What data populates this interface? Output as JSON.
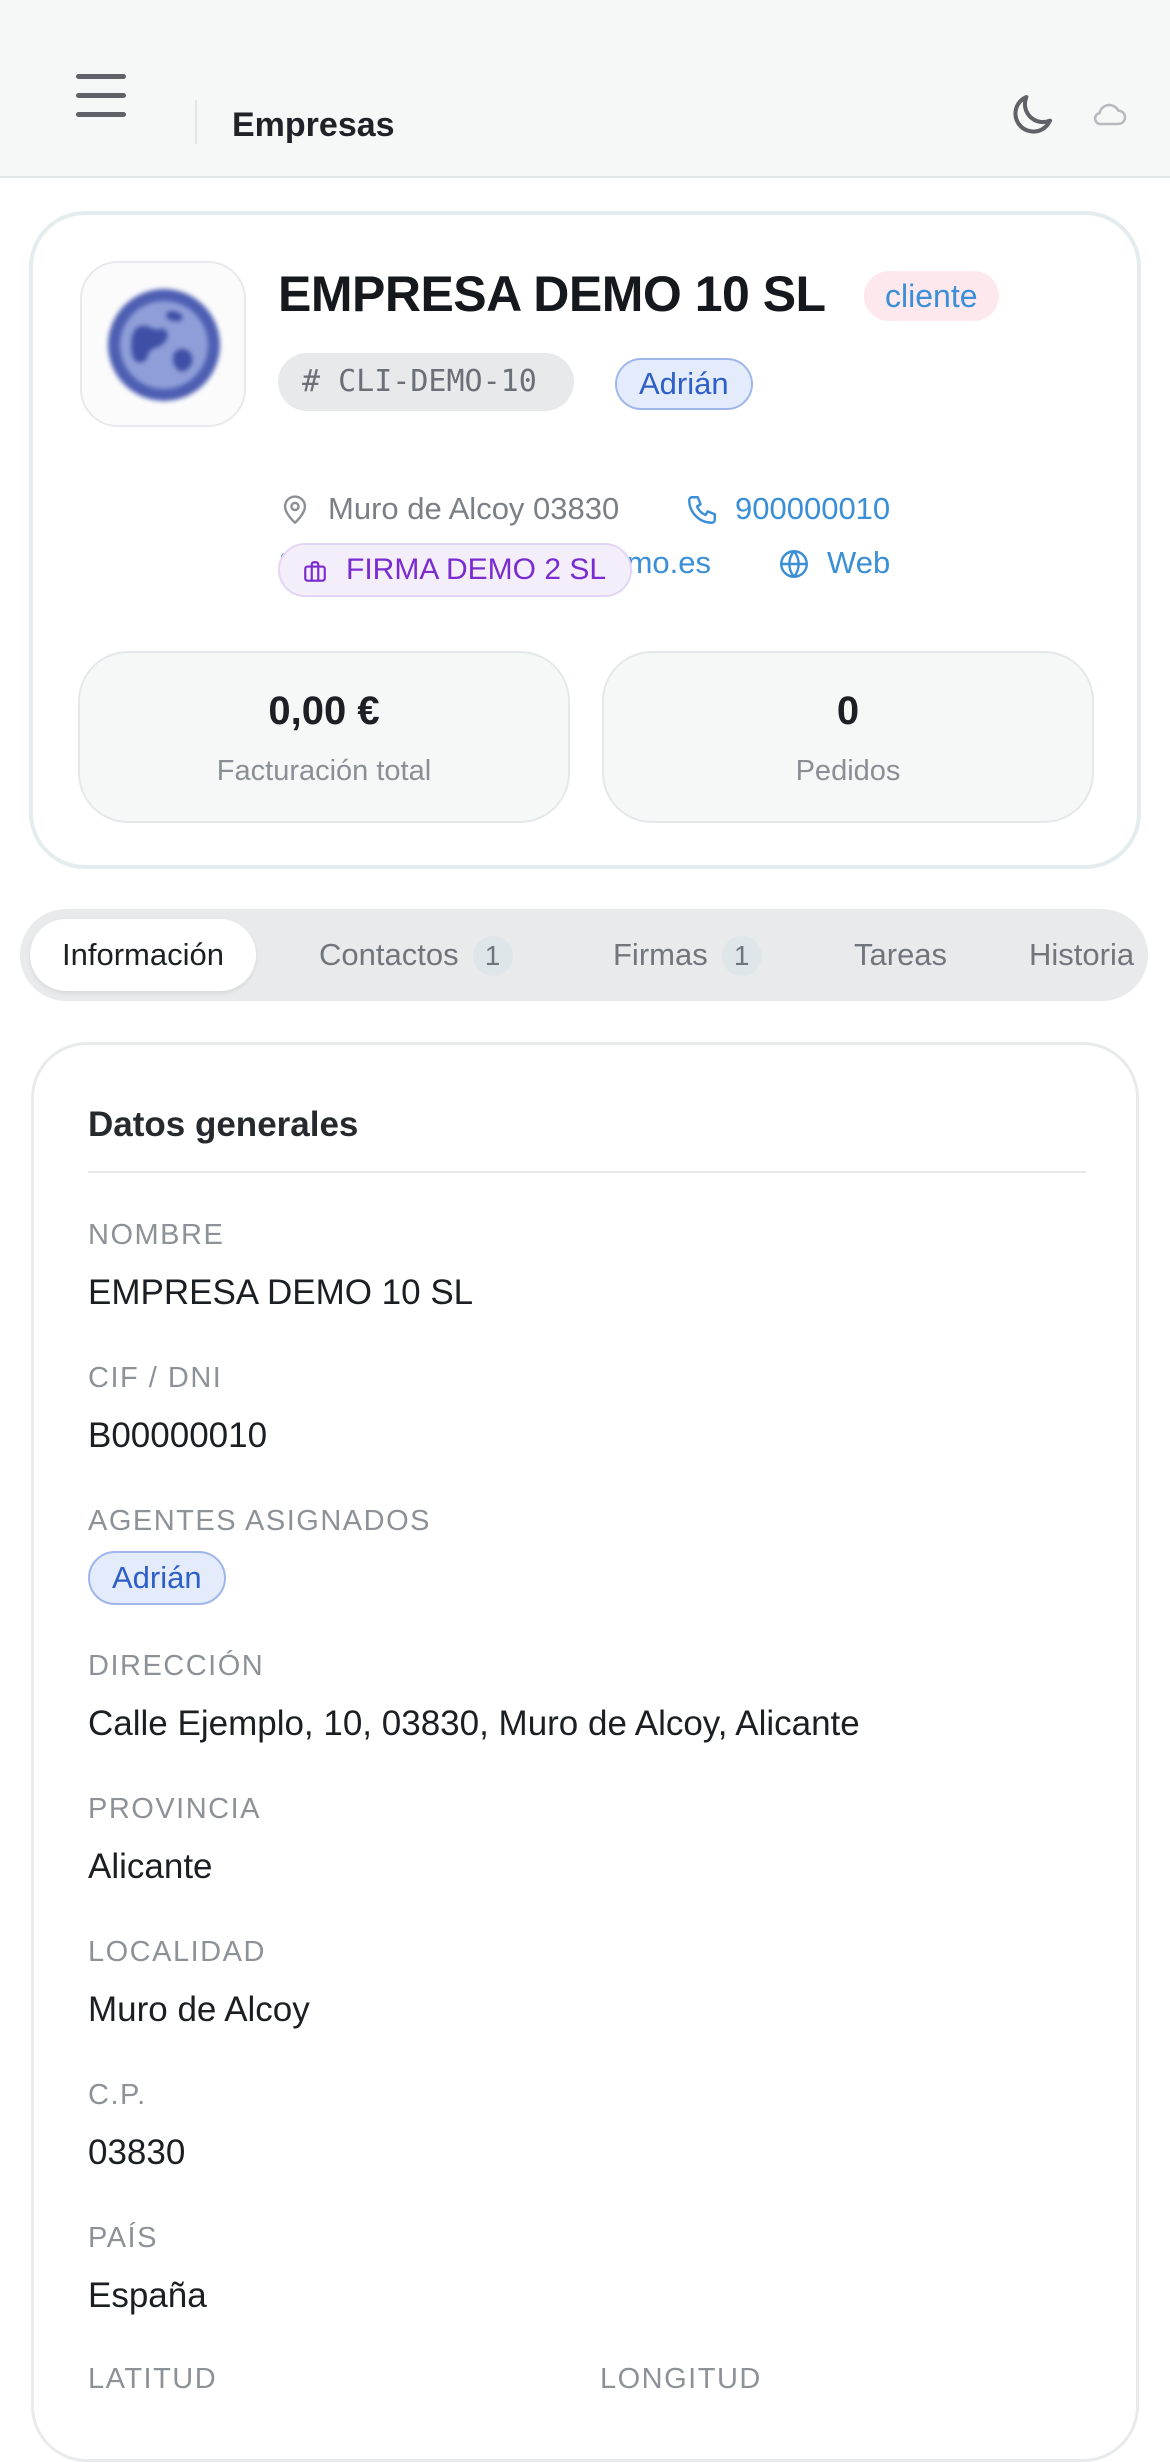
{
  "header": {
    "title": "Empresas"
  },
  "company": {
    "name": "EMPRESA DEMO 10 SL",
    "status": "cliente",
    "code": "# CLI-DEMO-10",
    "agent": "Adrián",
    "location": "Muro de Alcoy 03830",
    "phone": "900000010",
    "email": "demo10@empresademo.es",
    "web": "Web",
    "firma": "FIRMA DEMO 2 SL",
    "stats": [
      {
        "value": "0,00 €",
        "label": "Facturación total"
      },
      {
        "value": "0",
        "label": "Pedidos"
      }
    ]
  },
  "tabs": [
    {
      "label": "Información",
      "active": true
    },
    {
      "label": "Contactos",
      "count": "1"
    },
    {
      "label": "Firmas",
      "count": "1"
    },
    {
      "label": "Tareas"
    },
    {
      "label": "Historia"
    }
  ],
  "details": {
    "section_title": "Datos generales",
    "fields": [
      {
        "label": "NOMBRE",
        "value": "EMPRESA DEMO 10 SL"
      },
      {
        "label": "CIF / DNI",
        "value": "B00000010"
      },
      {
        "label": "AGENTES ASIGNADOS",
        "value": "Adrián"
      },
      {
        "label": "DIRECCIÓN",
        "value": "Calle Ejemplo, 10, 03830, Muro de Alcoy, Alicante"
      },
      {
        "label": "PROVINCIA",
        "value": "Alicante"
      },
      {
        "label": "LOCALIDAD",
        "value": "Muro de Alcoy"
      },
      {
        "label": "C.P.",
        "value": "03830"
      },
      {
        "label": "PAÍS",
        "value": "España"
      },
      {
        "label": "LATITUD",
        "value": ""
      },
      {
        "label": "LONGITUD",
        "value": ""
      }
    ]
  },
  "colors": {
    "accent_blue": "#3a8fd6",
    "agent_blue": "#2d5fc7",
    "status_pink_bg": "#fde8ee",
    "firma_purple": "#7a2cd0"
  },
  "icons": {
    "menu": "hamburger-icon",
    "theme": "moon-icon",
    "sync": "cloud-icon",
    "location": "map-pin-icon",
    "phone": "phone-icon",
    "email": "mail-icon",
    "web": "globe-icon",
    "firma": "briefcase-icon"
  }
}
